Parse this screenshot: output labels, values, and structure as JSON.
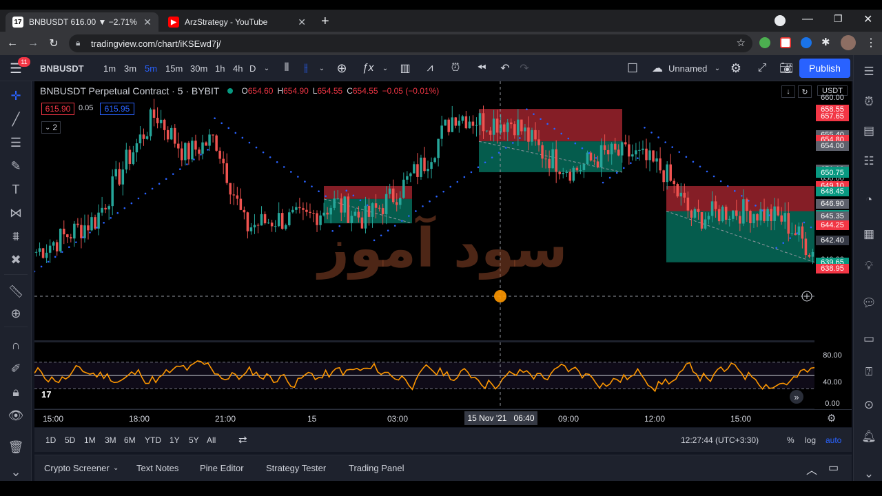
{
  "browser": {
    "tabs": [
      {
        "title": "BNBUSDT 616.00 ▼ −2.71% Unn",
        "favicon": "tradingview-icon"
      },
      {
        "title": "ArzStrategy - YouTube",
        "favicon": "youtube-icon"
      }
    ],
    "url": "tradingview.com/chart/iKSEwd7j/"
  },
  "toolbar": {
    "symbol": "BNBUSDT",
    "intervals": [
      "1m",
      "3m",
      "5m",
      "15m",
      "30m",
      "1h",
      "4h",
      "D"
    ],
    "active_interval": "5m",
    "layout_name": "Unnamed",
    "publish": "Publish",
    "notification_count": "11"
  },
  "legend": {
    "title": "BNBUSDT Perpetual Contract · 5 · BYBIT",
    "o_label": "O",
    "o": "654.60",
    "h_label": "H",
    "h": "654.90",
    "l_label": "L",
    "l": "654.55",
    "c_label": "C",
    "c": "654.55",
    "change": "−0.05 (−0.01%)",
    "bid": "615.90",
    "spread": "0.05",
    "ask": "615.95",
    "collapse": "2"
  },
  "watermark": "سود آموز",
  "price_axis": {
    "currency": "USDT",
    "ticks": [
      "660.00",
      "650.00",
      "640.00",
      "630.00"
    ],
    "labels": [
      {
        "value": "658.55",
        "color": "#f23645"
      },
      {
        "value": "657.65",
        "color": "#f23645"
      },
      {
        "value": "655.40",
        "color": "#5d606b"
      },
      {
        "value": "654.80",
        "color": "#f23645"
      },
      {
        "value": "654.00",
        "color": "#5d606b"
      },
      {
        "value": "651.10",
        "color": "#5d606b"
      },
      {
        "value": "650.90",
        "color": "#089981"
      },
      {
        "value": "650.75",
        "color": "#089981"
      },
      {
        "value": "649.10",
        "color": "#f23645"
      },
      {
        "value": "648.45",
        "color": "#089981"
      },
      {
        "value": "646.90",
        "color": "#5d606b"
      },
      {
        "value": "645.55",
        "color": "#089981"
      },
      {
        "value": "645.35",
        "color": "#5d606b"
      },
      {
        "value": "644.25",
        "color": "#f23645"
      },
      {
        "value": "642.40",
        "color": "#363a45"
      },
      {
        "value": "639.65",
        "color": "#089981"
      },
      {
        "value": "638.95",
        "color": "#f23645"
      }
    ],
    "osc_ticks": [
      "80.00",
      "40.00",
      "0.00"
    ]
  },
  "time_axis": {
    "labels": [
      "15:00",
      "18:00",
      "21:00",
      "15",
      "03:00",
      "09:00",
      "12:00",
      "15:00"
    ],
    "cursor": "15 Nov '21   06:40"
  },
  "range_bar": {
    "ranges": [
      "1D",
      "5D",
      "1M",
      "3M",
      "6M",
      "YTD",
      "1Y",
      "5Y",
      "All"
    ],
    "clock": "12:27:44 (UTC+3:30)",
    "pct": "%",
    "log": "log",
    "auto": "auto"
  },
  "bottom_panel": {
    "tabs": [
      "Crypto Screener",
      "Text Notes",
      "Pine Editor",
      "Strategy Tester",
      "Trading Panel"
    ]
  },
  "colors": {
    "up": "#26a69a",
    "down": "#ef5350",
    "accent": "#2962ff",
    "sar": "#2962ff",
    "osc": "#ff9800"
  },
  "chart_data": {
    "type": "candlestick",
    "symbol": "BNBUSDT",
    "interval": "5",
    "ylim": [
      630,
      662
    ],
    "close_path": [
      {
        "t": "14:00",
        "v": 641
      },
      {
        "t": "15:00",
        "v": 643
      },
      {
        "t": "16:00",
        "v": 645
      },
      {
        "t": "17:00",
        "v": 652
      },
      {
        "t": "18:00",
        "v": 658
      },
      {
        "t": "19:00",
        "v": 653
      },
      {
        "t": "20:00",
        "v": 655
      },
      {
        "t": "21:00",
        "v": 644
      },
      {
        "t": "22:00",
        "v": 645
      },
      {
        "t": "23:00",
        "v": 645
      },
      {
        "t": "00:00",
        "v": 647
      },
      {
        "t": "01:00",
        "v": 645
      },
      {
        "t": "02:00",
        "v": 648
      },
      {
        "t": "03:00",
        "v": 652
      },
      {
        "t": "04:00",
        "v": 658
      },
      {
        "t": "05:00",
        "v": 657
      },
      {
        "t": "06:00",
        "v": 657
      },
      {
        "t": "07:00",
        "v": 653
      },
      {
        "t": "08:00",
        "v": 651
      },
      {
        "t": "09:00",
        "v": 653
      },
      {
        "t": "10:00",
        "v": 653
      },
      {
        "t": "11:00",
        "v": 651
      },
      {
        "t": "12:00",
        "v": 645
      },
      {
        "t": "13:00",
        "v": 646
      },
      {
        "t": "14:00",
        "v": 646
      },
      {
        "t": "15:00",
        "v": 645
      },
      {
        "t": "16:00",
        "v": 641
      }
    ],
    "positions": [
      {
        "type": "short",
        "entry": 647.5,
        "stop": 649.1,
        "target": 644.5
      },
      {
        "type": "short",
        "entry": 654.6,
        "stop": 658.6,
        "target": 650.8
      },
      {
        "type": "short",
        "entry": 646.0,
        "stop": 649.1,
        "target": 639.7
      }
    ],
    "oscillator": {
      "ylim": [
        0,
        100
      ],
      "levels": [
        70,
        50,
        30
      ]
    }
  }
}
